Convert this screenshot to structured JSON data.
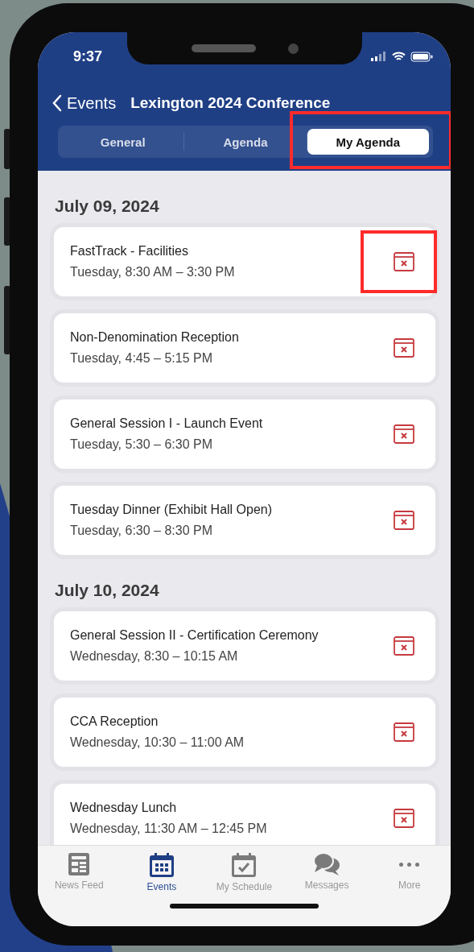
{
  "status_bar": {
    "time": "9:37"
  },
  "nav": {
    "back_label": "Events",
    "title": "Lexington 2024 Conference"
  },
  "tabs": [
    {
      "label": "General",
      "selected": false,
      "highlighted": false
    },
    {
      "label": "Agenda",
      "selected": false,
      "highlighted": false
    },
    {
      "label": "My Agenda",
      "selected": true,
      "highlighted": true
    }
  ],
  "sections": [
    {
      "date": "July 09, 2024",
      "events": [
        {
          "title": "FastTrack - Facilities",
          "time": "Tuesday, 8:30 AM – 3:30 PM",
          "highlighted": true
        },
        {
          "title": "Non-Denomination Reception",
          "time": "Tuesday, 4:45 – 5:15 PM",
          "highlighted": false
        },
        {
          "title": "General Session I - Launch Event",
          "time": "Tuesday, 5:30 – 6:30 PM",
          "highlighted": false
        },
        {
          "title": "Tuesday Dinner (Exhibit Hall Open)",
          "time": "Tuesday, 6:30 – 8:30 PM",
          "highlighted": false
        }
      ]
    },
    {
      "date": "July 10, 2024",
      "events": [
        {
          "title": "General Session II - Certification Ceremony",
          "time": "Wednesday, 8:30 – 10:15 AM",
          "highlighted": false
        },
        {
          "title": "CCA Reception",
          "time": "Wednesday, 10:30 – 11:00 AM",
          "highlighted": false
        },
        {
          "title": "Wednesday Lunch",
          "time": "Wednesday, 11:30 AM – 12:45 PM",
          "highlighted": false
        }
      ]
    }
  ],
  "tab_bar": [
    {
      "label": "News Feed",
      "kind": "news",
      "selected": false
    },
    {
      "label": "Events",
      "kind": "calendar",
      "selected": true
    },
    {
      "label": "My Schedule",
      "kind": "schedule",
      "selected": false
    },
    {
      "label": "Messages",
      "kind": "chat",
      "selected": false
    },
    {
      "label": "More",
      "kind": "more",
      "selected": false
    }
  ]
}
